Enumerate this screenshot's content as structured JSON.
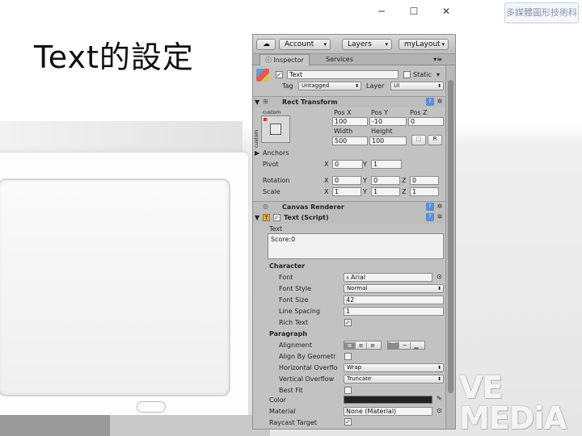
{
  "window_controls": {
    "minimize": "─",
    "maximize": "☐",
    "close": "✕"
  },
  "brand_box": "多媒體圖形技術科",
  "slide_title": "Text的設定",
  "logo": {
    "line1": "VE",
    "line2": "MEDiA"
  },
  "toolbar": {
    "cloud": "☁",
    "account": "Account",
    "layers": "Layers",
    "layout": "myLayout"
  },
  "tabs": {
    "inspector": "Inspector",
    "services": "Services",
    "menu": "▾≡"
  },
  "object": {
    "name": "Text",
    "static_label": "Static",
    "tag_label": "Tag",
    "tag_value": "Untagged",
    "layer_label": "Layer",
    "layer_value": "UI"
  },
  "rect_transform": {
    "title": "Rect Transform",
    "anchor_top": "custom",
    "anchor_side": "custom",
    "pos_x_label": "Pos X",
    "pos_y_label": "Pos Y",
    "pos_z_label": "Pos Z",
    "pos_x": "100",
    "pos_y": "-10",
    "pos_z": "0",
    "width_label": "Width",
    "height_label": "Height",
    "width": "500",
    "height": "100",
    "r_button": "R",
    "anchors_label": "Anchors",
    "pivot_label": "Pivot",
    "pivot_x": "0",
    "pivot_y": "1",
    "rotation_label": "Rotation",
    "rot_x": "0",
    "rot_y": "0",
    "rot_z": "0",
    "scale_label": "Scale",
    "scale_x": "1",
    "scale_y": "1",
    "scale_z": "1",
    "x": "X",
    "y": "Y",
    "z": "Z"
  },
  "canvas_renderer": {
    "title": "Canvas Renderer"
  },
  "text_script": {
    "title": "Text (Script)",
    "text_label": "Text",
    "text_value": "Score:0",
    "character_label": "Character",
    "font_label": "Font",
    "font_value": "Arial",
    "font_style_label": "Font Style",
    "font_style_value": "Normal",
    "font_size_label": "Font Size",
    "font_size_value": "42",
    "line_spacing_label": "Line Spacing",
    "line_spacing_value": "1",
    "rich_text_label": "Rich Text",
    "paragraph_label": "Paragraph",
    "alignment_label": "Alignment",
    "align_by_geometry_label": "Align By Geometr",
    "h_overflow_label": "Horizontal Overflo",
    "h_overflow_value": "Wrap",
    "v_overflow_label": "Vertical Overflow",
    "v_overflow_value": "Truncate",
    "best_fit_label": "Best Fit",
    "color_label": "Color",
    "color_value": "#222222",
    "material_label": "Material",
    "material_value": "None (Material)",
    "raycast_label": "Raycast Target"
  }
}
